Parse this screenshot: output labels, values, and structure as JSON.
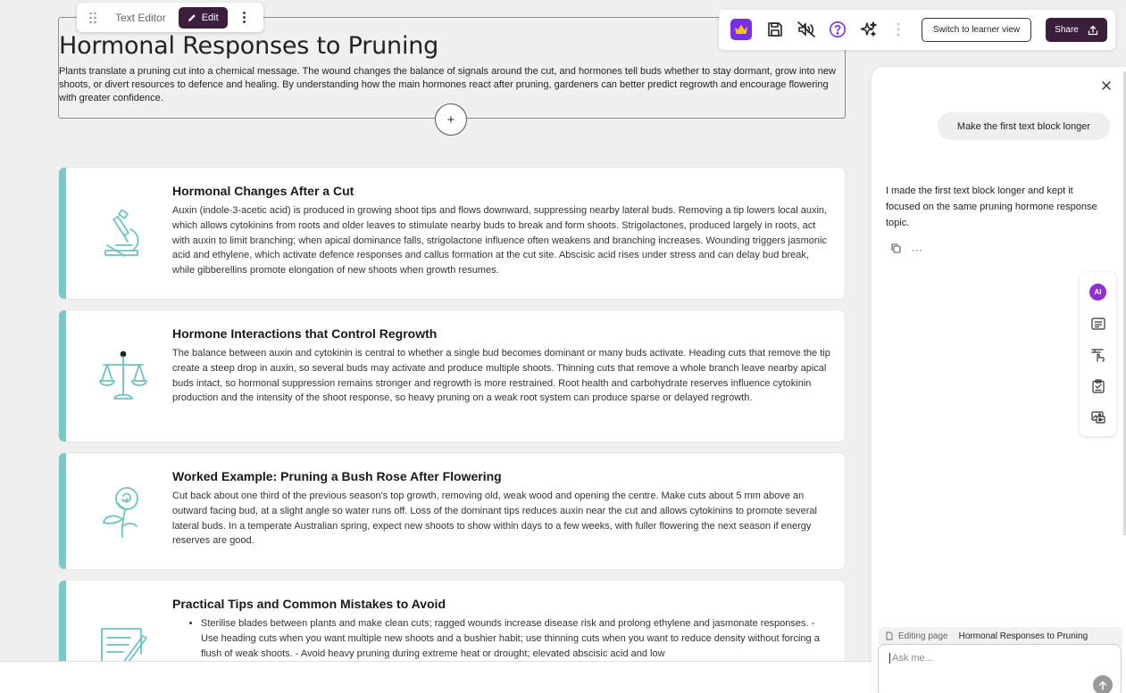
{
  "editor_toolbar": {
    "label": "Text Editor",
    "edit_label": "Edit"
  },
  "text_block": {
    "title": "Hormonal Responses to Pruning",
    "body": "Plants translate a pruning cut into a chemical message. The wound changes the balance of signals around the cut, and hormones tell buds whether to stay dormant, grow into new shoots, or divert resources to defence and healing. By understanding how the main hormones react after pruning, gardeners can better predict regrowth and encourage flowering with greater confidence.",
    "add_label": "+"
  },
  "cards": [
    {
      "icon": "microscope-icon",
      "title": "Hormonal Changes After a Cut",
      "body": "Auxin (indole-3-acetic acid) is produced in growing shoot tips and flows downward, suppressing nearby lateral buds. Removing a tip lowers local auxin, which allows cytokinins from roots and older leaves to stimulate nearby buds to break and form shoots. Strigolactones, produced largely in roots, act with auxin to limit branching; when apical dominance falls, strigolactone influence often weakens and branching increases. Wounding triggers jasmonic acid and ethylene, which activate defence responses and callus formation at the cut site. Abscisic acid rises under stress and can delay bud break, while gibberellins promote elongation of new shoots when growth resumes."
    },
    {
      "icon": "balance-scale-icon",
      "title": "Hormone Interactions that Control Regrowth",
      "body": "The balance between auxin and cytokinin is central to whether a single bud becomes dominant or many buds activate. Heading cuts that remove the tip create a steep drop in auxin, so several buds may activate and produce multiple shoots. Thinning cuts that remove a whole branch leave nearby apical buds intact, so hormonal suppression remains stronger and regrowth is more restrained. Root health and carbohydrate reserves influence cytokinin production and the intensity of the shoot response, so heavy pruning on a weak root system can produce sparse or delayed regrowth."
    },
    {
      "icon": "rose-icon",
      "title": "Worked Example: Pruning a Bush Rose After Flowering",
      "body": "Cut back about one third of the previous season's top growth, removing old, weak wood and opening the centre. Make cuts about 5 mm above an outward facing bud, at a slight angle so water runs off. Loss of the dominant tips reduces auxin near the cut and allows cytokinins to promote several lateral buds. In a temperate Australian spring, expect new shoots to show within days to a few weeks, with fuller flowering the next season if energy reserves are good."
    },
    {
      "icon": "notepad-pencil-icon",
      "title": "Practical Tips and Common Mistakes to Avoid",
      "bullets": [
        "Sterilise blades between plants and make clean cuts; ragged wounds increase disease risk and prolong ethylene and jasmonate responses. - Use heading cuts when you want multiple new shoots and a bushier habit; use thinning cuts when you want to reduce density without forcing a flush of weak shoots. - Avoid heavy pruning during extreme heat or drought; elevated abscisic acid and low"
      ]
    }
  ],
  "top_toolbar": {
    "icons": [
      "crown-icon",
      "save-icon",
      "audio-off-icon",
      "help-icon",
      "sparkles-icon",
      "more-icon"
    ],
    "learner_view_label": "Switch to learner view",
    "share_label": "Share"
  },
  "chat": {
    "user_message": "Make the first text block longer",
    "ai_message": "I made the first text block longer and kept it focused on the same pruning hormone response topic.",
    "more_label": "···",
    "side_tools": {
      "ai_label": "AI"
    },
    "editing_page_label": "Editing page",
    "editing_page_name": "Hormonal Responses to Pruning",
    "input_placeholder": "Ask me...",
    "input_value": ""
  },
  "colors": {
    "accent_teal": "#79c9c9",
    "dark_plum": "#3a1e3c",
    "purple": "#7a2fe6",
    "ai_purple": "#8e2fd6"
  }
}
